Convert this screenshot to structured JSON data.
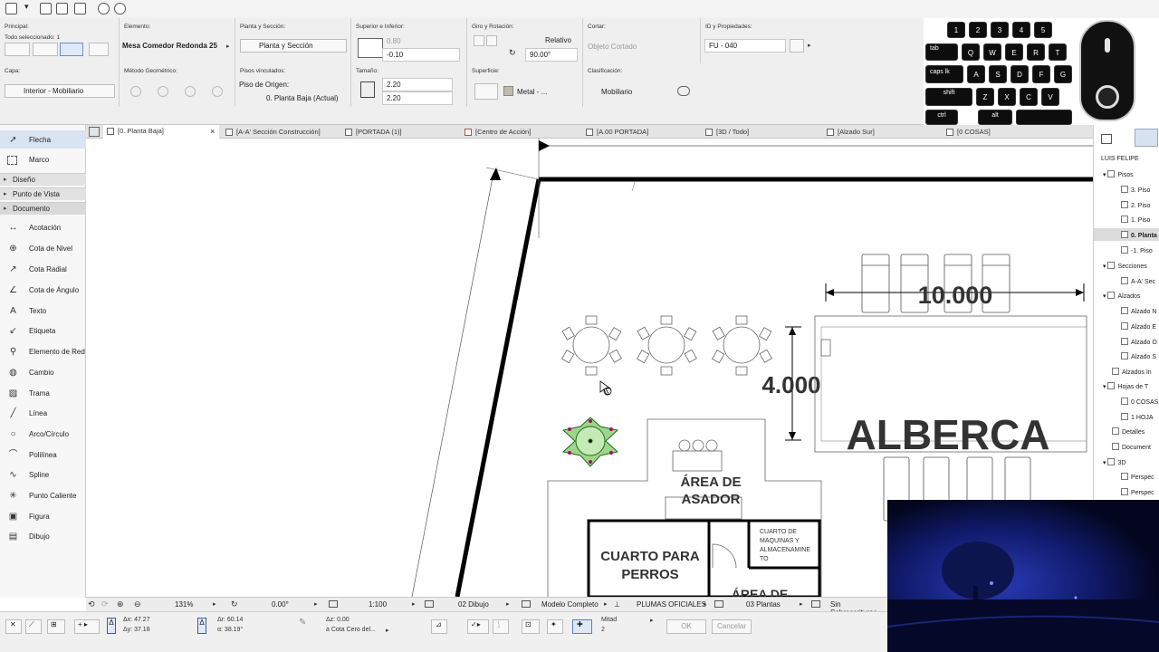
{
  "infobox": {
    "principal_h": "Principal:",
    "principal_sel": "Todo seleccionado: 1",
    "elemento_h": "Elemento:",
    "elemento": "Mesa Comedor Redonda 25",
    "planta_h": "Planta y Sección:",
    "planta": "Planta y Sección",
    "sup_h": "Superior e Inferior:",
    "sup_top": "0.80",
    "sup_bottom": "-0.10",
    "giro_h": "Giro y Rotación:",
    "giro_mode": "Relativo",
    "giro_angle": "90.00°",
    "cortar_h": "Cortar:",
    "cortar": "Objeto Cortado",
    "id_h": "ID y Propiedades:",
    "id": "FU - 040",
    "capa_h": "Capa:",
    "capa": "Interior - Mobiliario",
    "metodo_h": "Método Geométrico:",
    "pisos_h": "Pisos vinculados:",
    "piso_origen_label": "Piso de Origen:",
    "piso_origen": "0. Planta Baja (Actual)",
    "tam_h": "Tamaño:",
    "tam_a": "2.20",
    "tam_b": "2.20",
    "superficie_h": "Superficie:",
    "superficie": "Metal - ...",
    "clasif_h": "Clasificación:",
    "clasif": "Mobiliario"
  },
  "keyboard": {
    "row1": [
      "1",
      "2",
      "3",
      "4",
      "5"
    ],
    "row2": [
      "tab",
      "Q",
      "W",
      "E",
      "R",
      "T"
    ],
    "row3": [
      "caps lk",
      "A",
      "S",
      "D",
      "F",
      "G"
    ],
    "row4": [
      "shift",
      "Z",
      "X",
      "C",
      "V"
    ],
    "row5": [
      "ctrl",
      "alt"
    ]
  },
  "tabs": [
    "[0. Planta Baja]",
    "[A-A' Sección Construcción]",
    "[PORTADA (1)]",
    "[Centro de Acción]",
    "[A.00 PORTADA]",
    "[3D / Todo]",
    "[Alzado Sur]",
    "[0 COSAS]"
  ],
  "toolbox": {
    "top": [
      "Flecha",
      "Marco"
    ],
    "sections": [
      "Diseño",
      "Punto de Vista",
      "Documento"
    ],
    "tools": [
      "Acotación",
      "Cota de Nivel",
      "Cota Radial",
      "Cota de Ángulo",
      "Texto",
      "Etiqueta",
      "Elemento de Red",
      "Cambio",
      "Trama",
      "Línea",
      "Arco/Círculo",
      "Polilínea",
      "Spline",
      "Punto Caliente",
      "Figura",
      "Dibujo"
    ]
  },
  "navigator": {
    "project": "LUIS FELIPE",
    "items": [
      "Pisos",
      "3. Piso",
      "2. Piso",
      "1. Piso",
      "0. Planta",
      "-1. Piso",
      "Secciones",
      "A-A' Sec",
      "Alzados",
      "Alzado N",
      "Alzado E",
      "Alzado O",
      "Alzado S",
      "Alzados In",
      "Hojas de T",
      "0 COSAS",
      "1 HOJA",
      "Detalles",
      "Document",
      "3D",
      "Perspec",
      "Perspec"
    ]
  },
  "drawing": {
    "dim_horizontal": "10.000",
    "dim_vertical": "4.000",
    "pool_label": "ALBERCA",
    "asador_line1": "ÁREA DE",
    "asador_line2": "ASADOR",
    "perros_line1": "CUARTO PARA",
    "perros_line2": "PERROS",
    "maquinas_lines": [
      "CUARTO DE",
      "MAQUINAS Y",
      "ALMACENAMINE",
      "TO"
    ],
    "area_de_bottom": "ÁREA DE"
  },
  "statusbar": {
    "zoom": "131%",
    "angle": "0.00°",
    "scale": "1:100",
    "layer_combo": "02 Dibujo",
    "model_view": "Modelo Completo",
    "pen_set": "PLUMAS OFICIALES",
    "renovation": "03 Plantas",
    "override": "Sin Sobrescrituras"
  },
  "bottombar": {
    "dx": "Δx: 47.27",
    "dy": "Δy: 37.18",
    "dr": "Δr: 60.14",
    "da": "α: 38.19°",
    "dz": "Δz: 0.00",
    "cota": "a Cota Cero del...",
    "mitad": "Mitad",
    "mitad_n": "2",
    "ok": "OK",
    "cancel": "Cancelar"
  }
}
